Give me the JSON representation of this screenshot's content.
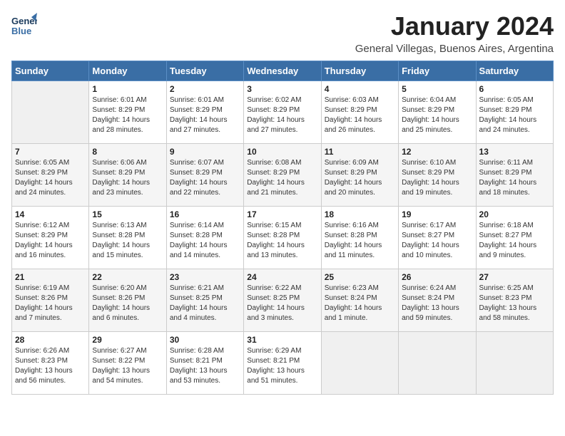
{
  "logo": {
    "text_line1": "General",
    "text_line2": "Blue"
  },
  "header": {
    "title": "January 2024",
    "subtitle": "General Villegas, Buenos Aires, Argentina"
  },
  "weekdays": [
    "Sunday",
    "Monday",
    "Tuesday",
    "Wednesday",
    "Thursday",
    "Friday",
    "Saturday"
  ],
  "weeks": [
    [
      {
        "day": "",
        "empty": true
      },
      {
        "day": "1",
        "sunrise": "6:01 AM",
        "sunset": "8:29 PM",
        "daylight": "14 hours and 28 minutes."
      },
      {
        "day": "2",
        "sunrise": "6:01 AM",
        "sunset": "8:29 PM",
        "daylight": "14 hours and 27 minutes."
      },
      {
        "day": "3",
        "sunrise": "6:02 AM",
        "sunset": "8:29 PM",
        "daylight": "14 hours and 27 minutes."
      },
      {
        "day": "4",
        "sunrise": "6:03 AM",
        "sunset": "8:29 PM",
        "daylight": "14 hours and 26 minutes."
      },
      {
        "day": "5",
        "sunrise": "6:04 AM",
        "sunset": "8:29 PM",
        "daylight": "14 hours and 25 minutes."
      },
      {
        "day": "6",
        "sunrise": "6:05 AM",
        "sunset": "8:29 PM",
        "daylight": "14 hours and 24 minutes."
      }
    ],
    [
      {
        "day": "7",
        "sunrise": "6:05 AM",
        "sunset": "8:29 PM",
        "daylight": "14 hours and 24 minutes."
      },
      {
        "day": "8",
        "sunrise": "6:06 AM",
        "sunset": "8:29 PM",
        "daylight": "14 hours and 23 minutes."
      },
      {
        "day": "9",
        "sunrise": "6:07 AM",
        "sunset": "8:29 PM",
        "daylight": "14 hours and 22 minutes."
      },
      {
        "day": "10",
        "sunrise": "6:08 AM",
        "sunset": "8:29 PM",
        "daylight": "14 hours and 21 minutes."
      },
      {
        "day": "11",
        "sunrise": "6:09 AM",
        "sunset": "8:29 PM",
        "daylight": "14 hours and 20 minutes."
      },
      {
        "day": "12",
        "sunrise": "6:10 AM",
        "sunset": "8:29 PM",
        "daylight": "14 hours and 19 minutes."
      },
      {
        "day": "13",
        "sunrise": "6:11 AM",
        "sunset": "8:29 PM",
        "daylight": "14 hours and 18 minutes."
      }
    ],
    [
      {
        "day": "14",
        "sunrise": "6:12 AM",
        "sunset": "8:29 PM",
        "daylight": "14 hours and 16 minutes."
      },
      {
        "day": "15",
        "sunrise": "6:13 AM",
        "sunset": "8:28 PM",
        "daylight": "14 hours and 15 minutes."
      },
      {
        "day": "16",
        "sunrise": "6:14 AM",
        "sunset": "8:28 PM",
        "daylight": "14 hours and 14 minutes."
      },
      {
        "day": "17",
        "sunrise": "6:15 AM",
        "sunset": "8:28 PM",
        "daylight": "14 hours and 13 minutes."
      },
      {
        "day": "18",
        "sunrise": "6:16 AM",
        "sunset": "8:28 PM",
        "daylight": "14 hours and 11 minutes."
      },
      {
        "day": "19",
        "sunrise": "6:17 AM",
        "sunset": "8:27 PM",
        "daylight": "14 hours and 10 minutes."
      },
      {
        "day": "20",
        "sunrise": "6:18 AM",
        "sunset": "8:27 PM",
        "daylight": "14 hours and 9 minutes."
      }
    ],
    [
      {
        "day": "21",
        "sunrise": "6:19 AM",
        "sunset": "8:26 PM",
        "daylight": "14 hours and 7 minutes."
      },
      {
        "day": "22",
        "sunrise": "6:20 AM",
        "sunset": "8:26 PM",
        "daylight": "14 hours and 6 minutes."
      },
      {
        "day": "23",
        "sunrise": "6:21 AM",
        "sunset": "8:25 PM",
        "daylight": "14 hours and 4 minutes."
      },
      {
        "day": "24",
        "sunrise": "6:22 AM",
        "sunset": "8:25 PM",
        "daylight": "14 hours and 3 minutes."
      },
      {
        "day": "25",
        "sunrise": "6:23 AM",
        "sunset": "8:24 PM",
        "daylight": "14 hours and 1 minute."
      },
      {
        "day": "26",
        "sunrise": "6:24 AM",
        "sunset": "8:24 PM",
        "daylight": "13 hours and 59 minutes."
      },
      {
        "day": "27",
        "sunrise": "6:25 AM",
        "sunset": "8:23 PM",
        "daylight": "13 hours and 58 minutes."
      }
    ],
    [
      {
        "day": "28",
        "sunrise": "6:26 AM",
        "sunset": "8:23 PM",
        "daylight": "13 hours and 56 minutes."
      },
      {
        "day": "29",
        "sunrise": "6:27 AM",
        "sunset": "8:22 PM",
        "daylight": "13 hours and 54 minutes."
      },
      {
        "day": "30",
        "sunrise": "6:28 AM",
        "sunset": "8:21 PM",
        "daylight": "13 hours and 53 minutes."
      },
      {
        "day": "31",
        "sunrise": "6:29 AM",
        "sunset": "8:21 PM",
        "daylight": "13 hours and 51 minutes."
      },
      {
        "day": "",
        "empty": true
      },
      {
        "day": "",
        "empty": true
      },
      {
        "day": "",
        "empty": true
      }
    ]
  ]
}
